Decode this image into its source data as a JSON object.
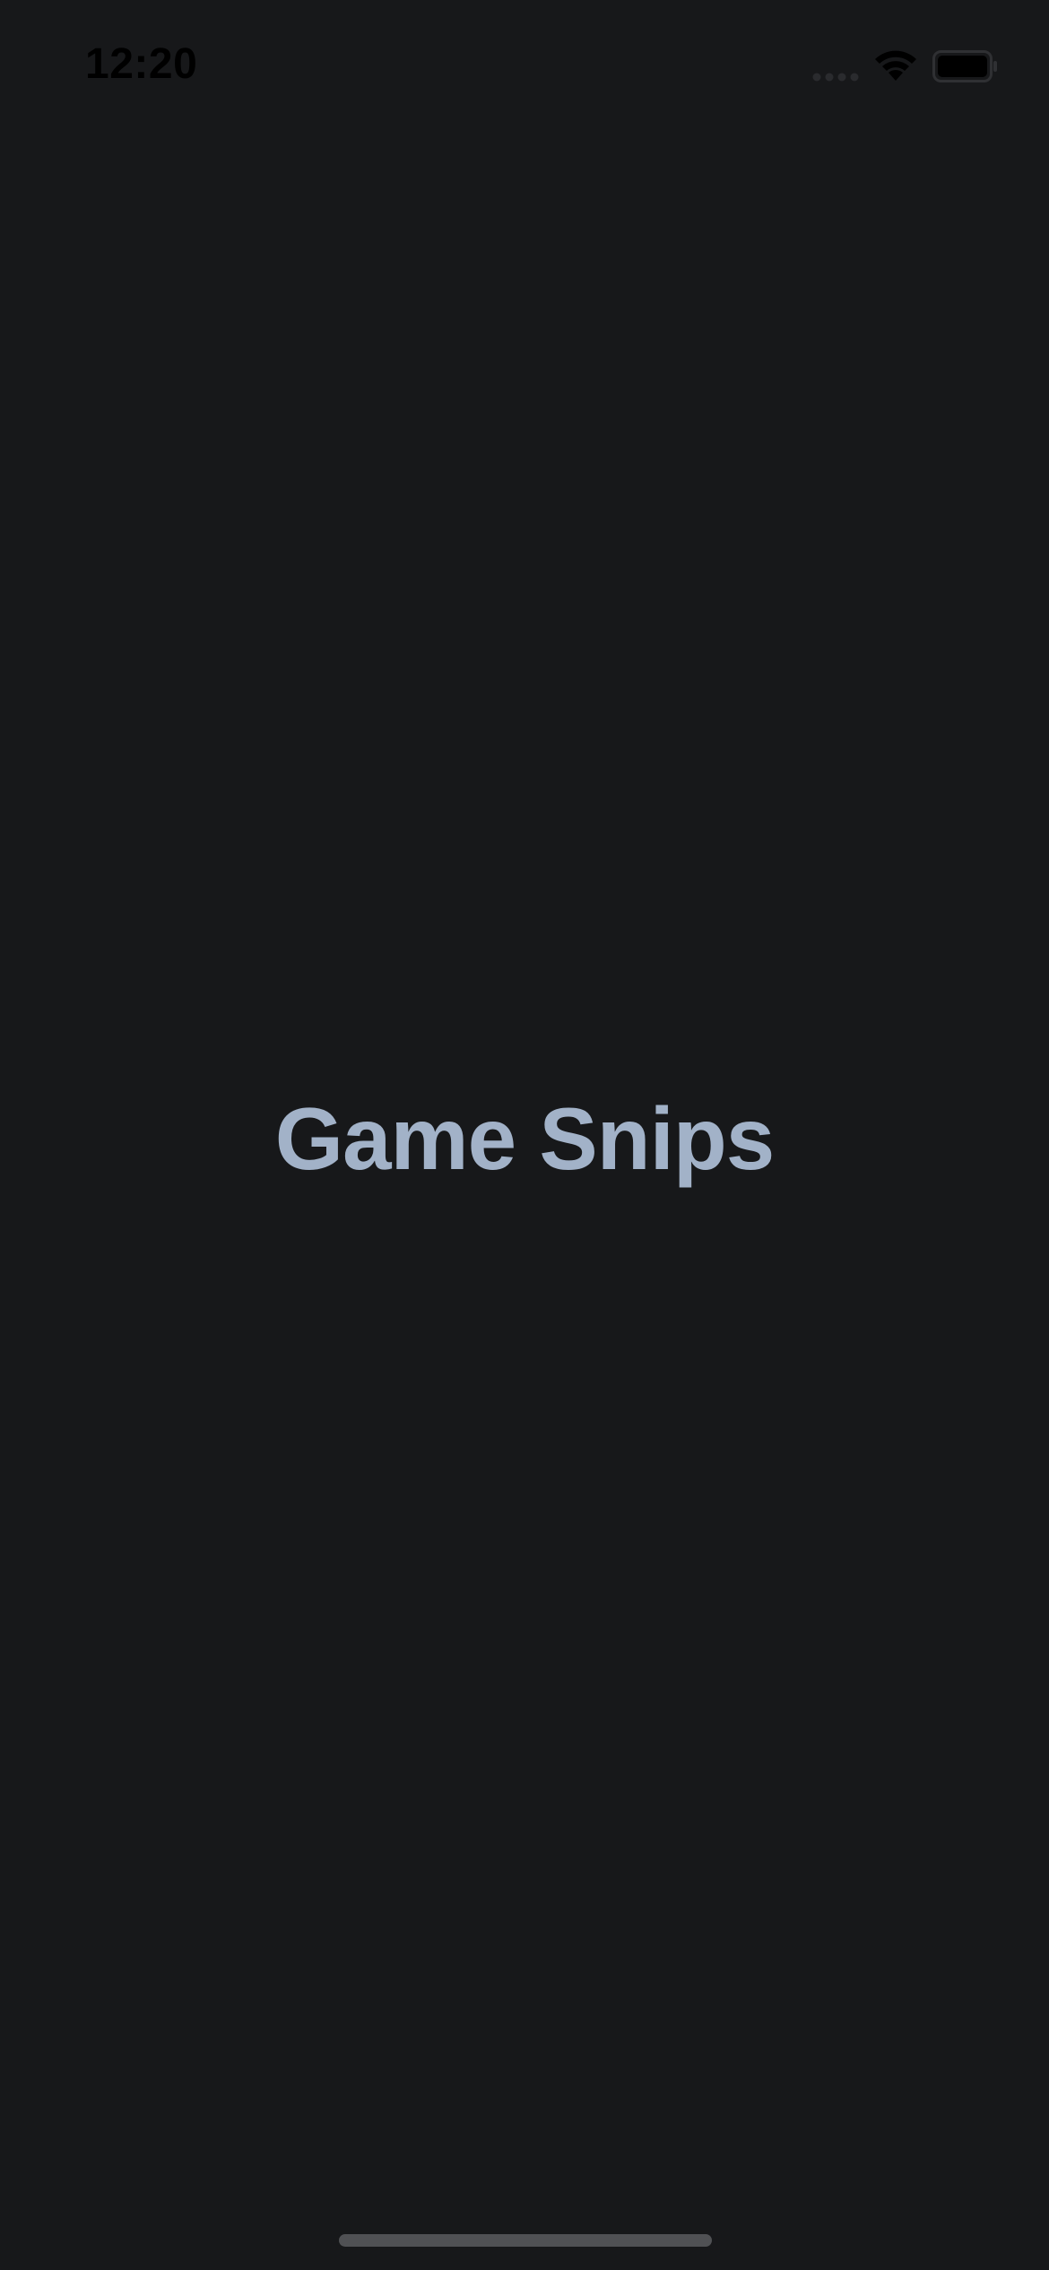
{
  "status_bar": {
    "time": "12:20",
    "icons": [
      "cellular-signal-icon",
      "wifi-icon",
      "battery-icon"
    ]
  },
  "main": {
    "title": "Game Snips"
  },
  "colors": {
    "background": "#17181a",
    "title": "#a2b2c8",
    "status_text": "#000000",
    "home_indicator": "#505154"
  }
}
